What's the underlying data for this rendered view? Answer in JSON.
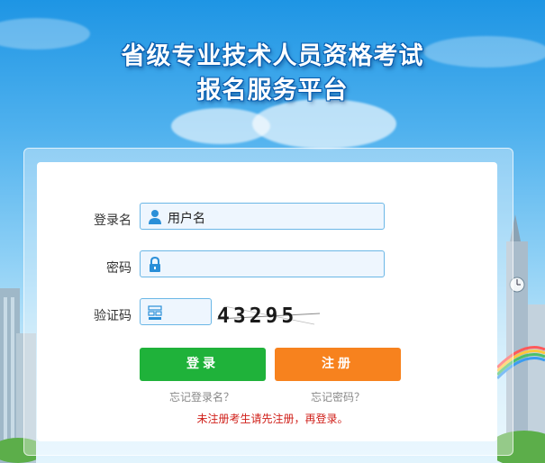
{
  "header": {
    "title_line1": "省级专业技术人员资格考试",
    "title_line2": "报名服务平台"
  },
  "form": {
    "username_label": "登录名",
    "username_value": "用户名",
    "password_label": "密码",
    "password_value": "",
    "captcha_label": "验证码",
    "captcha_value": "",
    "captcha_code": "43295"
  },
  "buttons": {
    "login": "登录",
    "register": "注册"
  },
  "links": {
    "forgot_username": "忘记登录名？",
    "forgot_password": "忘记密码？"
  },
  "notice": "未注册考生请先注册，再登录。",
  "colors": {
    "login_button": "#1fb23a",
    "register_button": "#f7821e",
    "notice_text": "#d0201a",
    "field_border": "#6bb7e6"
  },
  "icons": {
    "username": "user-icon",
    "password": "lock-icon",
    "captcha": "captcha-icon"
  }
}
